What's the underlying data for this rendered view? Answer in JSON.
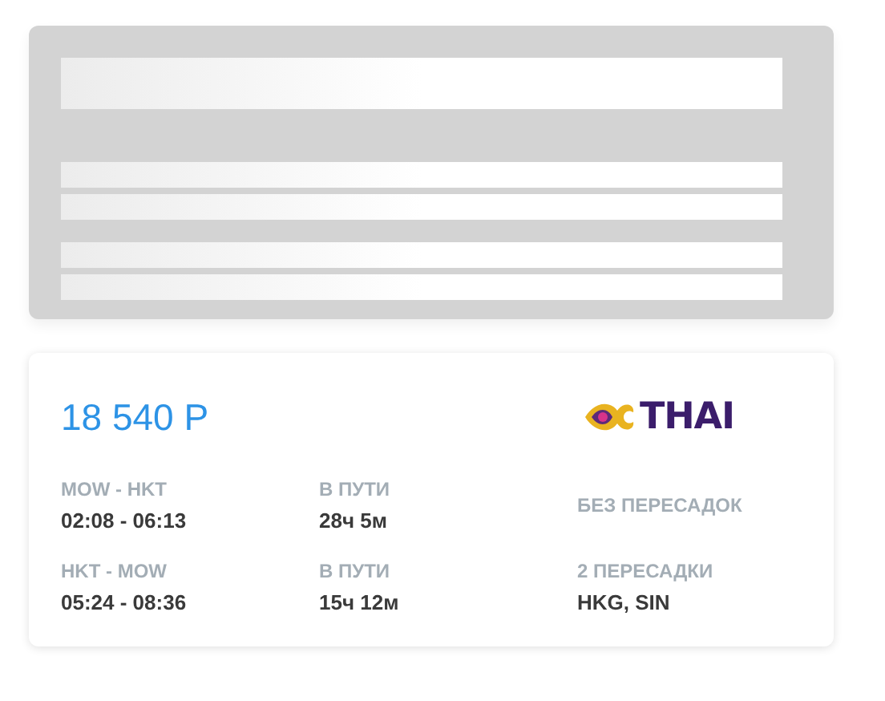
{
  "loading_card": {
    "kind": "skeleton"
  },
  "ticket": {
    "price": "18 540 Р",
    "airline": "THAI",
    "legs": [
      {
        "route": "MOW - HKT",
        "times": "02:08 - 06:13",
        "duration_label": "В ПУТИ",
        "duration": "28ч 5м",
        "stops_label": "БЕЗ ПЕРЕСАДОК"
      },
      {
        "route": "HKT - MOW",
        "times": "05:24 - 08:36",
        "duration_label": "В ПУТИ",
        "duration": "15ч 12м",
        "stops_label": "2 ПЕРЕСАДКИ",
        "stops": "HKG, SIN"
      }
    ]
  }
}
